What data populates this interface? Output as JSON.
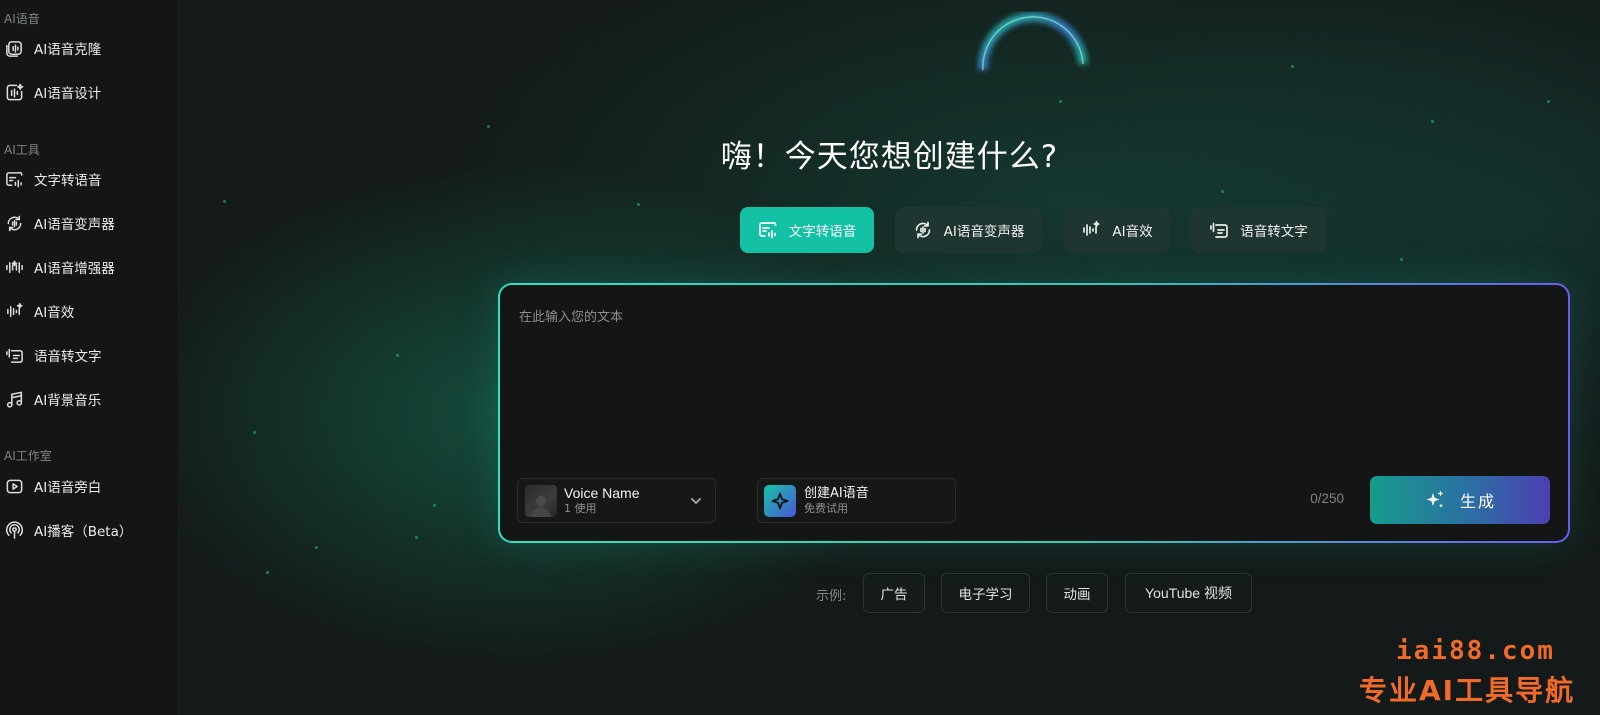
{
  "sidebar": {
    "sections": [
      {
        "label": "AI语音",
        "items": [
          {
            "label": "AI语音克隆",
            "icon": "voice-clone-icon"
          },
          {
            "label": "AI语音设计",
            "icon": "voice-design-icon"
          }
        ]
      },
      {
        "label": "AI工具",
        "items": [
          {
            "label": "文字转语音",
            "icon": "text-to-speech-icon"
          },
          {
            "label": "AI语音变声器",
            "icon": "voice-changer-icon"
          },
          {
            "label": "AI语音增强器",
            "icon": "voice-enhancer-icon"
          },
          {
            "label": "AI音效",
            "icon": "sound-effect-icon"
          },
          {
            "label": "语音转文字",
            "icon": "speech-to-text-icon"
          },
          {
            "label": "AI背景音乐",
            "icon": "music-note-icon"
          }
        ]
      },
      {
        "label": "AI工作室",
        "items": [
          {
            "label": "AI语音旁白",
            "icon": "voiceover-icon"
          },
          {
            "label": "AI播客（Beta）",
            "icon": "podcast-icon"
          }
        ]
      }
    ]
  },
  "main": {
    "heading": "嗨！今天您想创建什么?",
    "tabs": [
      {
        "label": "文字转语音",
        "icon": "text-to-speech-icon",
        "active": true
      },
      {
        "label": "AI语音变声器",
        "icon": "voice-changer-icon",
        "active": false
      },
      {
        "label": "AI音效",
        "icon": "sound-effect-icon",
        "active": false
      },
      {
        "label": "语音转文字",
        "icon": "speech-to-text-icon",
        "active": false
      }
    ],
    "input": {
      "placeholder": "在此输入您的文本",
      "value": "",
      "counter": "0/250"
    },
    "voice_select": {
      "name": "Voice Name",
      "usage": "1 使用"
    },
    "create_voice": {
      "title": "创建AI语音",
      "subtitle": "免费试用"
    },
    "generate_label": "生成",
    "examples": {
      "label": "示例:",
      "chips": [
        "广告",
        "电子学习",
        "动画",
        "YouTube 视频"
      ]
    }
  },
  "watermark": {
    "url": "iai88.com",
    "text": "专业AI工具导航"
  },
  "colors": {
    "accent": "#13c2a4",
    "tab_bg": "#1f3531",
    "watermark": "#f06a2a",
    "sidebar_bg": "#141515"
  }
}
